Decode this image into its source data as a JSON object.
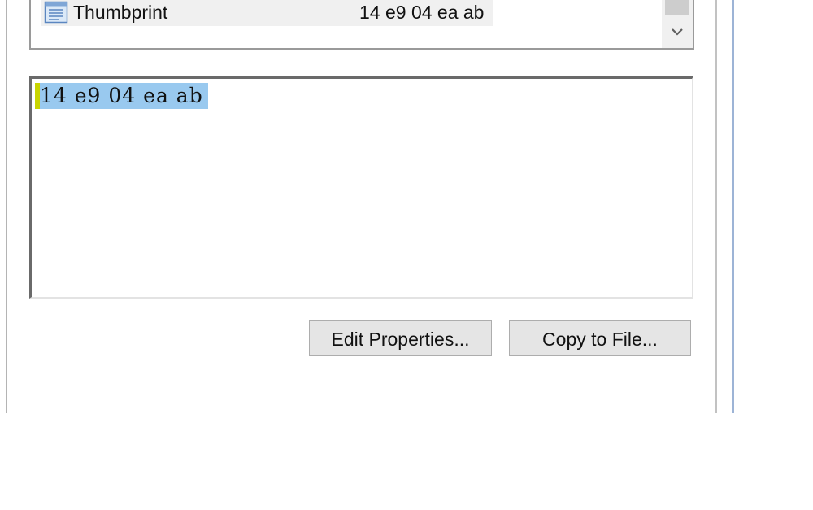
{
  "field_list": {
    "selected_row": {
      "field_name": "Thumbprint",
      "field_value": "14 e9 04 ea ab",
      "icon": "property-document-icon"
    },
    "scrollbar": {
      "down_icon": "chevron-down-icon"
    }
  },
  "value_box": {
    "text": "14 e9 04 ea ab"
  },
  "buttons": {
    "edit_properties": "Edit Properties...",
    "copy_to_file": "Copy to File..."
  },
  "colors": {
    "selection_highlight": "#99c9ef",
    "row_background": "#f0f0f0",
    "button_face": "#e5e5e5",
    "window_border": "#9db4d6"
  }
}
